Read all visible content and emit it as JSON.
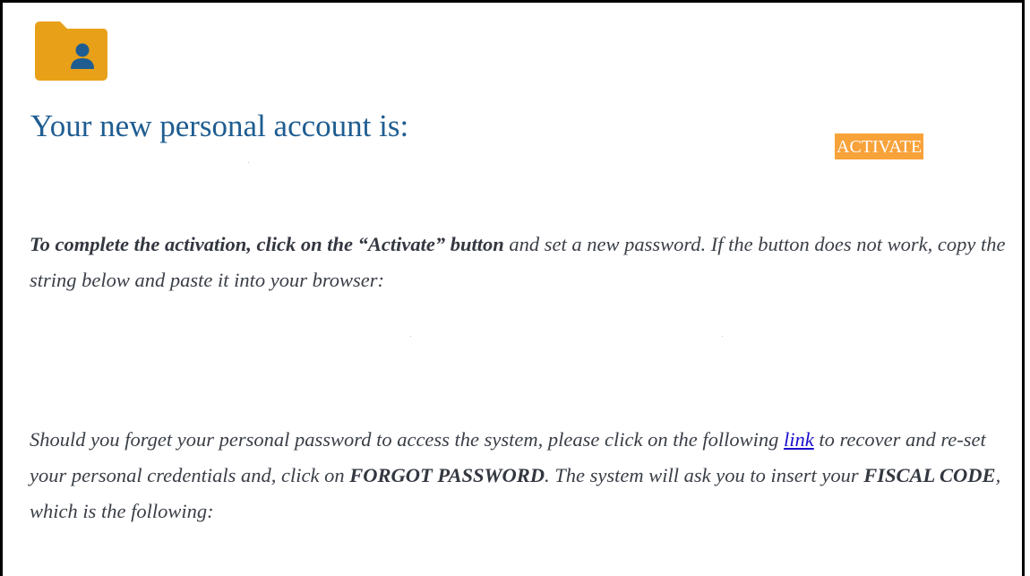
{
  "icon": {
    "name": "folder-user-icon",
    "folder_color": "#e8a019",
    "person_color": "#1f5d91"
  },
  "title": "Your new personal account is:",
  "activate_button": {
    "label": "ACTIVATE",
    "color": "#f8a23a"
  },
  "activation_paragraph": {
    "bold": "To complete the activation, click on the “Activate” button",
    "rest": " and set a new password. If the button does not work, copy the string below and paste it into your browser:"
  },
  "recovery_paragraph": {
    "text_1": "Should you forget your personal password to access the system, please click on the following ",
    "link_label": "link",
    "text_2": " to recover and re-set your personal credentials and, click on ",
    "forgot_password": "FORGOT PASSWORD",
    "text_3": ". The system will ask you to insert your ",
    "fiscal_code": "FISCAL CODE",
    "text_4": ", which is the following:"
  },
  "colors": {
    "title": "#1f5d91",
    "body_text": "#3a3f47",
    "link": "#1a0dcc"
  }
}
